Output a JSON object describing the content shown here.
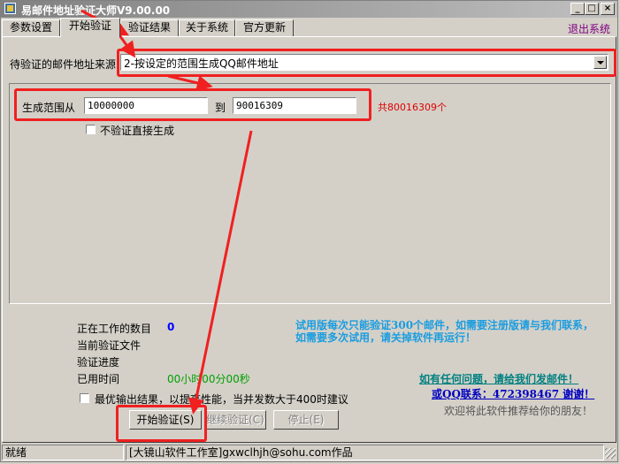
{
  "window": {
    "title": "易邮件地址验证大师V9.00.00"
  },
  "tabs": [
    {
      "label": "参数设置"
    },
    {
      "label": "开始验证"
    },
    {
      "label": "验证结果"
    },
    {
      "label": "关于系统"
    },
    {
      "label": "官方更新"
    }
  ],
  "exit_label": "退出系统",
  "source": {
    "label": "待验证的邮件地址来源",
    "selected": "2-按设定的范围生成QQ邮件地址"
  },
  "range": {
    "from_label": "生成范围从",
    "from_value": "10000000",
    "to_label": "到",
    "to_value": "90016309",
    "count_text": "共80016309个"
  },
  "no_verify_label": "不验证直接生成",
  "status": {
    "working_label": "正在工作的数目",
    "working_value": "0",
    "current_file_label": "当前验证文件",
    "progress_label": "验证进度",
    "elapsed_label": "已用时间",
    "elapsed_value": "00小时00分00秒"
  },
  "optimize_label": "最优输出结果，以提高性能，当并发数大于400时建议",
  "buttons": {
    "start": "开始验证(S)",
    "continue": "继续验证(C)",
    "stop": "停止(E)"
  },
  "notes": {
    "trial": "试用版每次只能验证300个邮件，如需要注册版请与我们联系，如需要多次试用，请关掉软件再运行！",
    "contact_email": "如有任何问题，请给我们发邮件！",
    "contact_qq": "或QQ联系：472398467   谢谢！",
    "recommend": "欢迎将此软件推荐给你的朋友！"
  },
  "statusbar": {
    "state": "就绪",
    "credit": "[大镜山软件工作室]gxwclhjh@sohu.com作品"
  },
  "colors": {
    "face": "#d4d0c8",
    "highlight_red": "#f02020",
    "count_red": "#e00000",
    "note_blue": "#1a9de0",
    "timer_green": "#00a000"
  }
}
